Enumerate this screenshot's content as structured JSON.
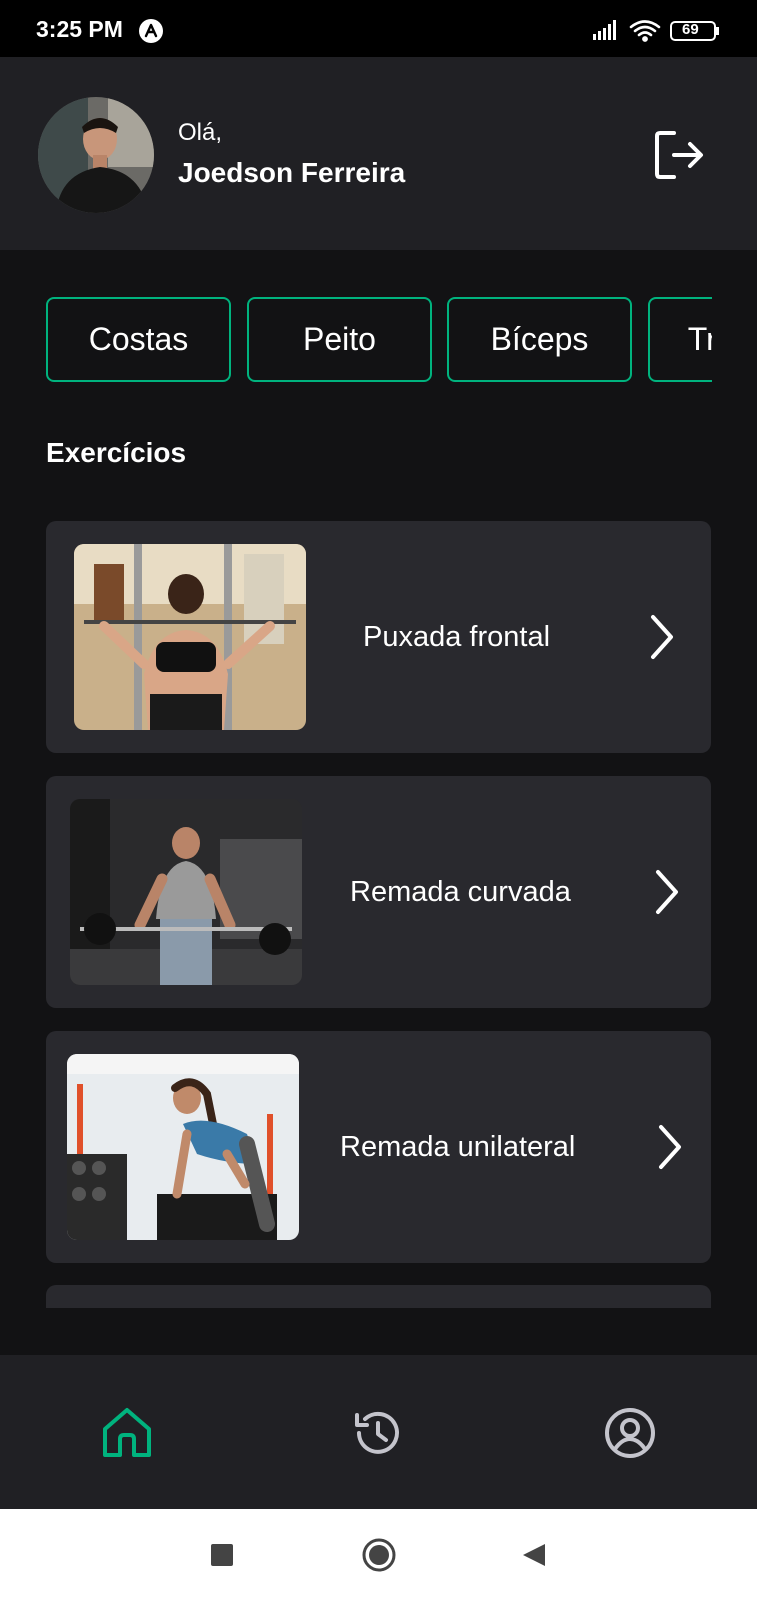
{
  "status_bar": {
    "time": "3:25 PM",
    "battery": "69"
  },
  "header": {
    "greeting": "Olá,",
    "user_name": "Joedson Ferreira"
  },
  "categories": [
    "Costas",
    "Peito",
    "Bíceps",
    "Tríceps"
  ],
  "section_title": "Exercícios",
  "exercises": [
    {
      "name": "Puxada frontal"
    },
    {
      "name": "Remada curvada"
    },
    {
      "name": "Remada unilateral"
    }
  ],
  "bottom_nav": {
    "items": [
      {
        "icon": "home-icon",
        "active": true
      },
      {
        "icon": "history-icon",
        "active": false
      },
      {
        "icon": "profile-icon",
        "active": false
      }
    ]
  },
  "colors": {
    "accent": "#00b37e",
    "background": "#121214",
    "header": "#202024",
    "card": "#29292e"
  }
}
